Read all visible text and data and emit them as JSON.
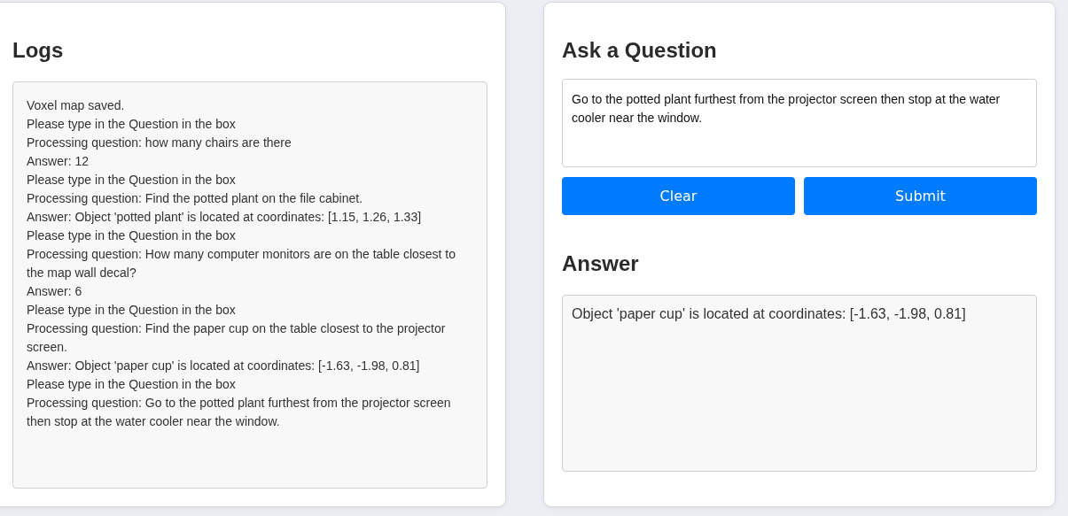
{
  "logs": {
    "title": "Logs",
    "lines": [
      "Voxel map saved.",
      "Please type in the Question in the box",
      "Processing question: how many chairs are there",
      "Answer: 12",
      "Please type in the Question in the box",
      "Processing question: Find the potted plant on the file cabinet.",
      "Answer: Object 'potted plant' is located at coordinates: [1.15, 1.26, 1.33]",
      "Please type in the Question in the box",
      "Processing question: How many computer monitors are on the table closest to the map wall decal?",
      "Answer: 6",
      "Please type in the Question in the box",
      "Processing question: Find the paper cup on the table closest to the projector screen.",
      "Answer: Object 'paper cup' is located at coordinates: [-1.63, -1.98, 0.81]",
      "Please type in the Question in the box",
      "Processing question: Go to the potted plant furthest from the projector screen then stop at the water cooler near the window."
    ]
  },
  "ask": {
    "title": "Ask a Question",
    "question": "Go to the potted plant furthest from the projector screen then stop at the water cooler near the window.",
    "buttons": [
      "Clear",
      "Submit"
    ]
  },
  "answer": {
    "title": "Answer",
    "text": "Object 'paper cup' is located at coordinates: [-1.63, -1.98, 0.81]"
  }
}
